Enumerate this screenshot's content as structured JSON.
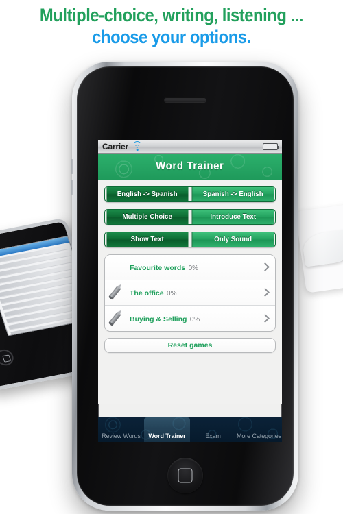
{
  "marketing": {
    "line1": "Multiple-choice, writing, listening ...",
    "line2": "choose your options.",
    "line1_color": "#22a05c",
    "line2_color": "#199be8"
  },
  "device": {
    "type": "iphone",
    "home_button": "home-button",
    "speaker": "earpiece-speaker"
  },
  "statusbar": {
    "carrier": "Carrier",
    "wifi_icon": "wifi-icon",
    "battery_icon": "battery-icon"
  },
  "titlebar": {
    "title": "Word Trainer",
    "background": "#229a5b"
  },
  "segments": [
    {
      "name": "direction",
      "options": [
        {
          "label": "English -> Spanish",
          "selected": true
        },
        {
          "label": "Spanish -> English",
          "selected": false
        }
      ]
    },
    {
      "name": "answer-mode",
      "options": [
        {
          "label": "Multiple Choice",
          "selected": true
        },
        {
          "label": "Introduce Text",
          "selected": false
        }
      ]
    },
    {
      "name": "presentation-mode",
      "options": [
        {
          "label": "Show Text",
          "selected": true
        },
        {
          "label": "Only Sound",
          "selected": false
        }
      ]
    }
  ],
  "list": {
    "rows": [
      {
        "name": "Favourite words",
        "progress": "0%",
        "icon": ""
      },
      {
        "name": "The office",
        "progress": "0%",
        "icon": "pencil-icon"
      },
      {
        "name": "Buying & Selling",
        "progress": "0%",
        "icon": "pencil-icon"
      }
    ],
    "chevron_icon": "chevron-right-icon",
    "name_color": "#1fa05c"
  },
  "reset_button": {
    "label": "Reset games"
  },
  "tabbar": {
    "tabs": [
      {
        "label": "Review Words",
        "active": false
      },
      {
        "label": "Word Trainer",
        "active": true
      },
      {
        "label": "Exam",
        "active": false
      },
      {
        "label": "More Categories",
        "active": false
      }
    ]
  }
}
